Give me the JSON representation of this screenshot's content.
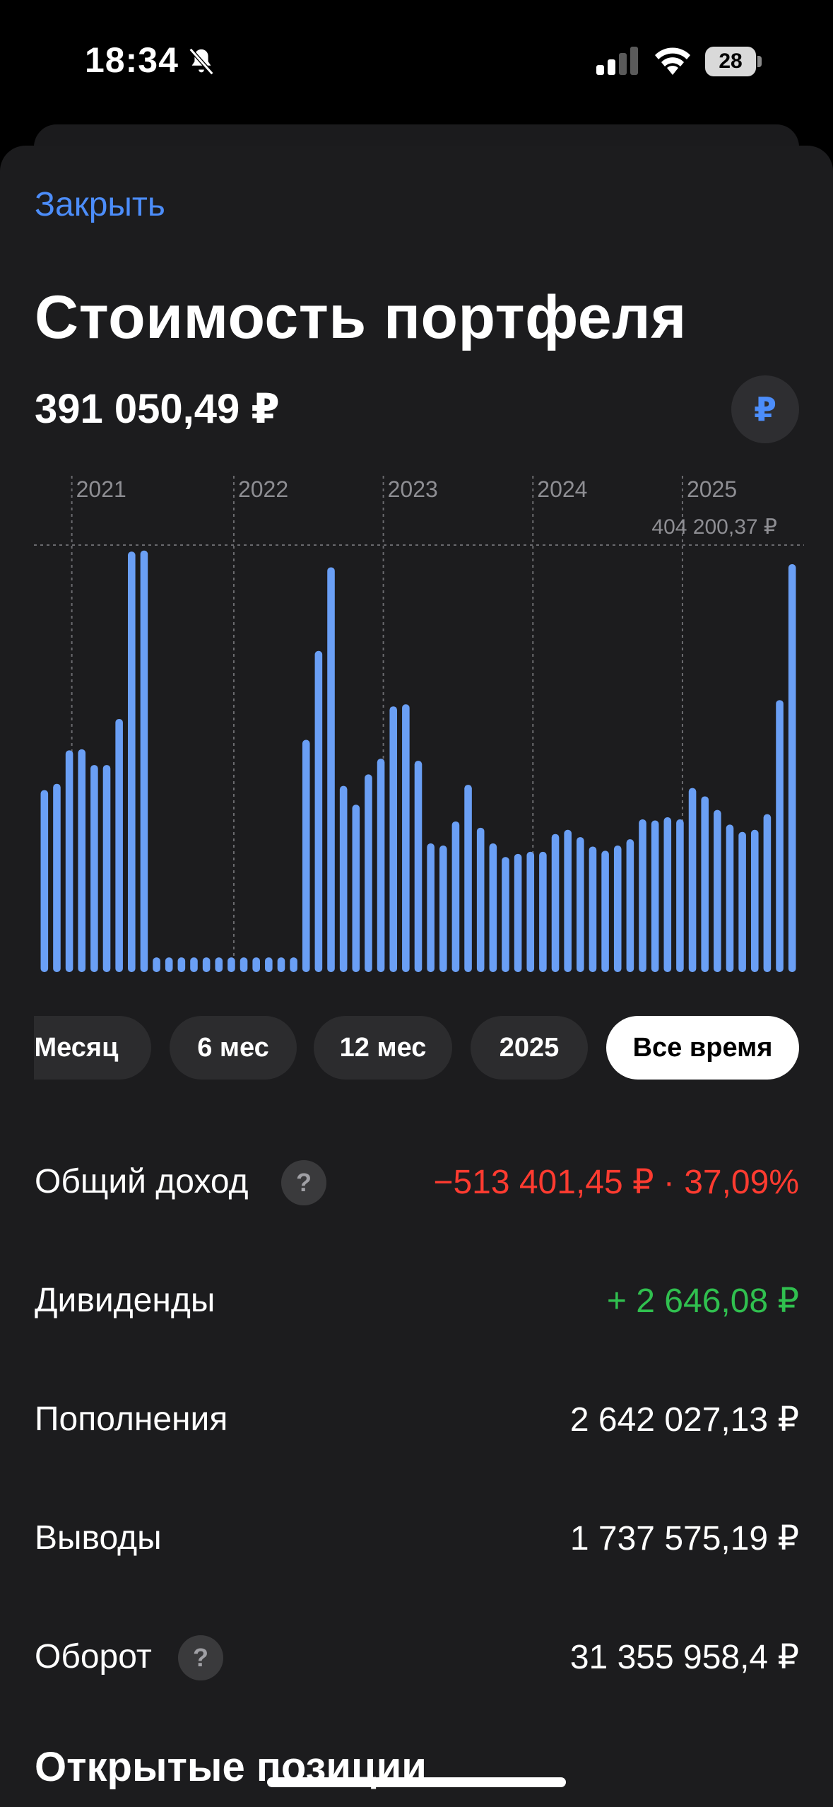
{
  "status_bar": {
    "time": "18:34",
    "battery": "28"
  },
  "header": {
    "close_label": "Закрыть",
    "title": "Стоимость портфеля",
    "portfolio_value": "391 050,49 ₽",
    "currency_symbol": "₽"
  },
  "chart_data": {
    "type": "bar",
    "year_markers": [
      "2021",
      "2022",
      "2023",
      "2024",
      "2025"
    ],
    "max_label": "404 200,37 ₽",
    "max_value": 404200.37,
    "values": [
      174000,
      180000,
      212000,
      213000,
      198000,
      198000,
      242000,
      402000,
      403000,
      14000,
      14000,
      14000,
      14000,
      14000,
      14000,
      14000,
      14000,
      14000,
      14000,
      14000,
      14000,
      222000,
      307000,
      387000,
      178000,
      160000,
      189000,
      204000,
      254000,
      256000,
      202000,
      123000,
      121000,
      144000,
      179000,
      138000,
      123000,
      110000,
      113000,
      115000,
      115000,
      132000,
      136000,
      129000,
      120000,
      116000,
      121000,
      127000,
      146000,
      145000,
      148000,
      146000,
      176000,
      168000,
      155000,
      141000,
      134000,
      136000,
      151000,
      260000,
      390000
    ],
    "ylim": [
      0,
      404200.37
    ]
  },
  "periods": [
    "Месяц",
    "6 мес",
    "12 мес",
    "2025",
    "Все время"
  ],
  "stats": {
    "income_label": "Общий доход",
    "income_value": "−513 401,45 ₽ · 37,09%",
    "dividends_label": "Дивиденды",
    "dividends_value": "+ 2 646,08 ₽",
    "deposits_label": "Пополнения",
    "deposits_value": "2 642 027,13 ₽",
    "withdrawals_label": "Выводы",
    "withdrawals_value": "1 737 575,19 ₽",
    "turnover_label": "Оборот",
    "turnover_value": "31 355 958,4 ₽",
    "help_symbol": "?"
  },
  "open_positions_title": "Открытые позиции",
  "colors": {
    "accent": "#4c8dfa",
    "bar": "#6a9ff5",
    "negative": "#ff3b30",
    "positive": "#30c04f",
    "sheet": "#1c1c1e"
  }
}
